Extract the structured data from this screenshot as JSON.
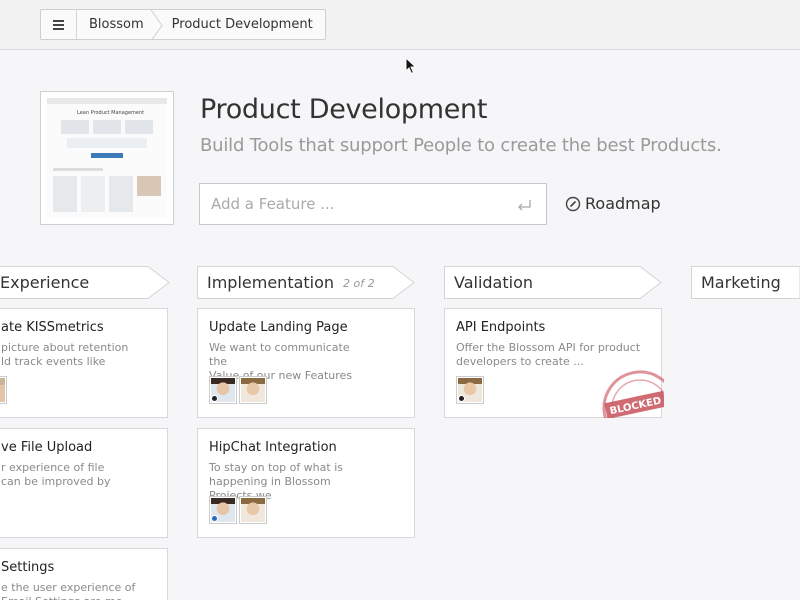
{
  "breadcrumb": {
    "items": [
      "Blossom",
      "Product Development"
    ]
  },
  "header": {
    "title": "Product Development",
    "subtitle": "Build Tools that support People to create the best Products."
  },
  "thumbnail": {
    "title": "Lean Product Management"
  },
  "feature_input": {
    "placeholder": "Add a Feature ...",
    "value": ""
  },
  "roadmap": {
    "label": "Roadmap"
  },
  "columns": [
    {
      "name": "Experience",
      "count": "",
      "cards": [
        {
          "title": "ate KISSmetrics",
          "desc": "picture about retention\nld track events like",
          "avatars": 1
        },
        {
          "title": "ve File Upload",
          "desc": "r experience of file\ncan be improved by",
          "avatars": 0
        },
        {
          "title": "Settings",
          "desc": "e the user experience of\nEmail Settings are me",
          "avatars": 0
        }
      ]
    },
    {
      "name": "Implementation",
      "count": "2 of 2",
      "cards": [
        {
          "title": "Update Landing Page",
          "desc": "We want to communicate the\nValue of our new Features",
          "avatars": 2
        },
        {
          "title": "HipChat Integration",
          "desc": "To stay on top of what is\nhappening in Blossom Projects we",
          "avatars": 2
        }
      ]
    },
    {
      "name": "Validation",
      "count": "",
      "cards": [
        {
          "title": "API Endpoints",
          "desc": "Offer the Blossom API for product\ndevelopers to create ...",
          "avatars": 1,
          "stamp": "BLOCKED"
        }
      ]
    },
    {
      "name": "Marketing",
      "count": "",
      "cards": []
    }
  ],
  "colors": {
    "accent": "#3c7ab8",
    "stamp": "#c8505a",
    "background": "#f6f6f8"
  },
  "icons": [
    "menu-icon",
    "enter-icon",
    "compass-icon",
    "mouse-cursor-icon"
  ]
}
